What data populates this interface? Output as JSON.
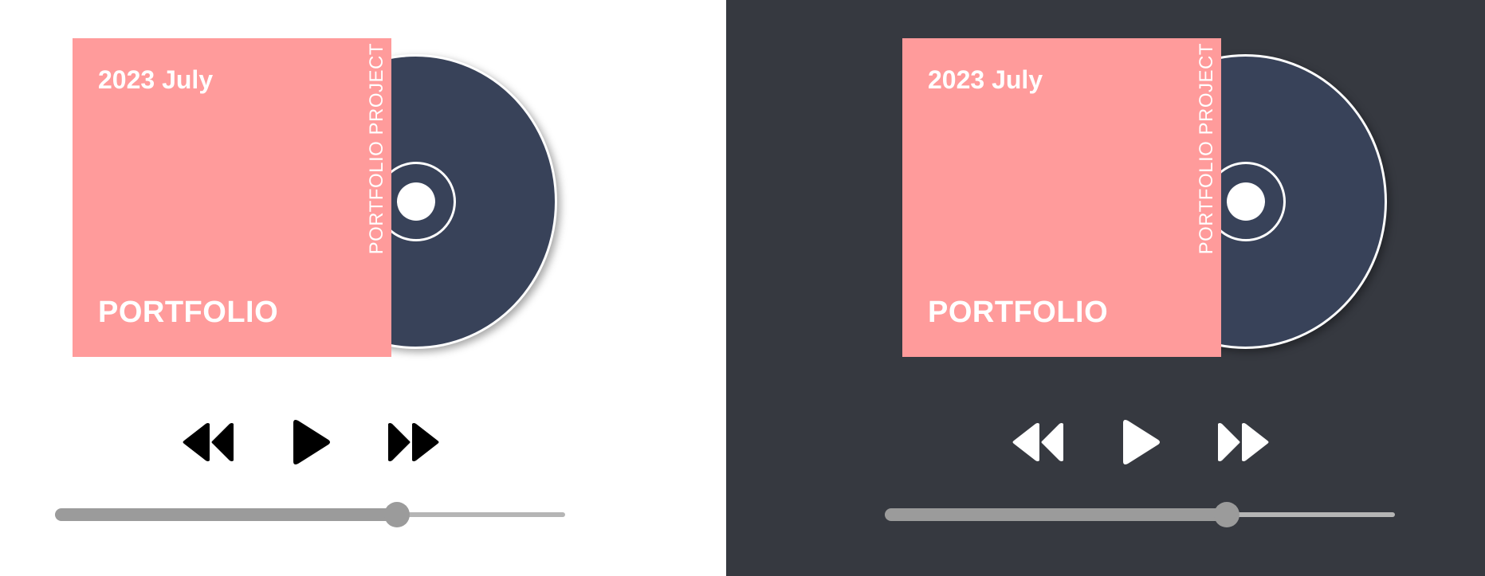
{
  "players": [
    {
      "theme": "light",
      "background": "#ffffff",
      "cover": {
        "date": "2023 July",
        "title": "PORTFOLIO",
        "side_text": "PORTFOLIO PROJECT",
        "color": "#ff9b9b"
      },
      "disc": {
        "color": "#384259",
        "ring_color": "#ffffff"
      },
      "controls": {
        "previous_icon": "rewind-icon",
        "play_icon": "play-icon",
        "next_icon": "fast-forward-icon",
        "icon_color": "#000000"
      },
      "progress": 0.67
    },
    {
      "theme": "dark",
      "background": "#363940",
      "cover": {
        "date": "2023 July",
        "title": "PORTFOLIO",
        "side_text": "PORTFOLIO PROJECT",
        "color": "#ff9b9b"
      },
      "disc": {
        "color": "#384259",
        "ring_color": "#ffffff"
      },
      "controls": {
        "previous_icon": "rewind-icon",
        "play_icon": "play-icon",
        "next_icon": "fast-forward-icon",
        "icon_color": "#ffffff"
      },
      "progress": 0.67
    }
  ]
}
